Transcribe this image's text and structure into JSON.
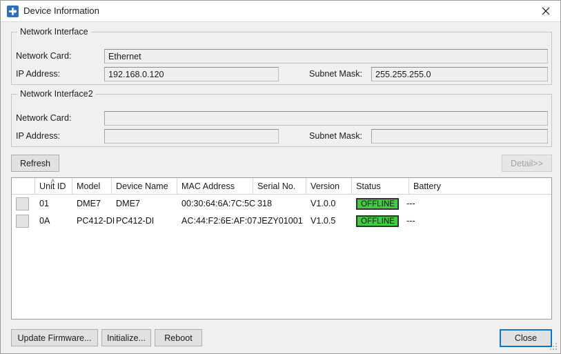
{
  "window": {
    "title": "Device Information",
    "icon": "network-device-icon",
    "close_icon": "close-icon"
  },
  "network_interface": {
    "legend": "Network Interface",
    "network_card_label": "Network Card:",
    "network_card_value": "Ethernet",
    "ip_address_label": "IP Address:",
    "ip_address_value": "192.168.0.120",
    "subnet_mask_label": "Subnet Mask:",
    "subnet_mask_value": "255.255.255.0"
  },
  "network_interface2": {
    "legend": "Network Interface2",
    "network_card_label": "Network Card:",
    "network_card_value": "",
    "ip_address_label": "IP Address:",
    "ip_address_value": "",
    "subnet_mask_label": "Subnet Mask:",
    "subnet_mask_value": ""
  },
  "toolbar": {
    "refresh_label": "Refresh",
    "detail_label": "Detail>>",
    "detail_enabled": false
  },
  "table": {
    "sort_indicator": "ascending",
    "sort_caret": "˄",
    "columns": [
      {
        "key": "select",
        "label": ""
      },
      {
        "key": "unit_id",
        "label": "Unit ID"
      },
      {
        "key": "model",
        "label": "Model"
      },
      {
        "key": "device_name",
        "label": "Device Name"
      },
      {
        "key": "mac_address",
        "label": "MAC Address"
      },
      {
        "key": "serial_no",
        "label": "Serial No."
      },
      {
        "key": "version",
        "label": "Version"
      },
      {
        "key": "status",
        "label": "Status"
      },
      {
        "key": "battery",
        "label": "Battery"
      }
    ],
    "rows": [
      {
        "unit_id": "01",
        "model": "DME7",
        "device_name": "DME7",
        "mac_address": "00:30:64:6A:7C:5C",
        "serial_no": "318",
        "version": "V1.0.0",
        "status": "OFFLINE",
        "battery": "---"
      },
      {
        "unit_id": "0A",
        "model": "PC412-DI",
        "device_name": "PC412-DI",
        "mac_address": "AC:44:F2:6E:AF:07",
        "serial_no": "JEZY01001",
        "version": "V1.0.5",
        "status": "OFFLINE",
        "battery": "---"
      }
    ]
  },
  "footer": {
    "update_firmware_label": "Update Firmware...",
    "initialize_label": "Initialize...",
    "reboot_label": "Reboot",
    "close_label": "Close"
  },
  "colors": {
    "status_offline_bg": "#3fcc3f",
    "status_offline_border": "#333333",
    "title_icon_bg": "#2f6fc0",
    "default_button_border": "#0078d7",
    "window_bg": "#f0f0f0"
  }
}
